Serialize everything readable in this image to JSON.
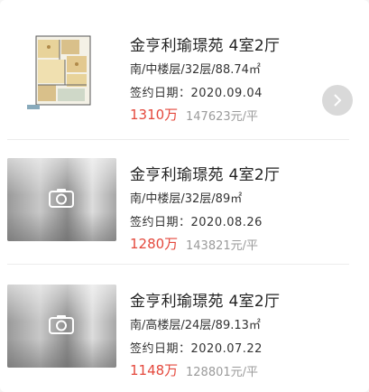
{
  "listings": [
    {
      "title": "金亨利瑜璟苑 4室2厅",
      "meta": "南/中楼层/32层/88.74㎡",
      "date": "签约日期：2020.09.04",
      "total_price": "1310万",
      "unit_price": "147623元/平",
      "image": "floor-plan"
    },
    {
      "title": "金亨利瑜璟苑 4室2厅",
      "meta": "南/中楼层/32层/89㎡",
      "date": "签约日期：2020.08.26",
      "total_price": "1280万",
      "unit_price": "143821元/平",
      "image": "blurred-photo"
    },
    {
      "title": "金亨利瑜璟苑 4室2厅",
      "meta": "南/高楼层/24层/89.13㎡",
      "date": "签约日期：2020.07.22",
      "total_price": "1148万",
      "unit_price": "128801元/平",
      "image": "blurred-photo"
    }
  ],
  "next_icon": "chevron-right-icon",
  "colors": {
    "price": "#e4483c",
    "muted": "#9b9b9b",
    "button": "#d9d9d9"
  }
}
